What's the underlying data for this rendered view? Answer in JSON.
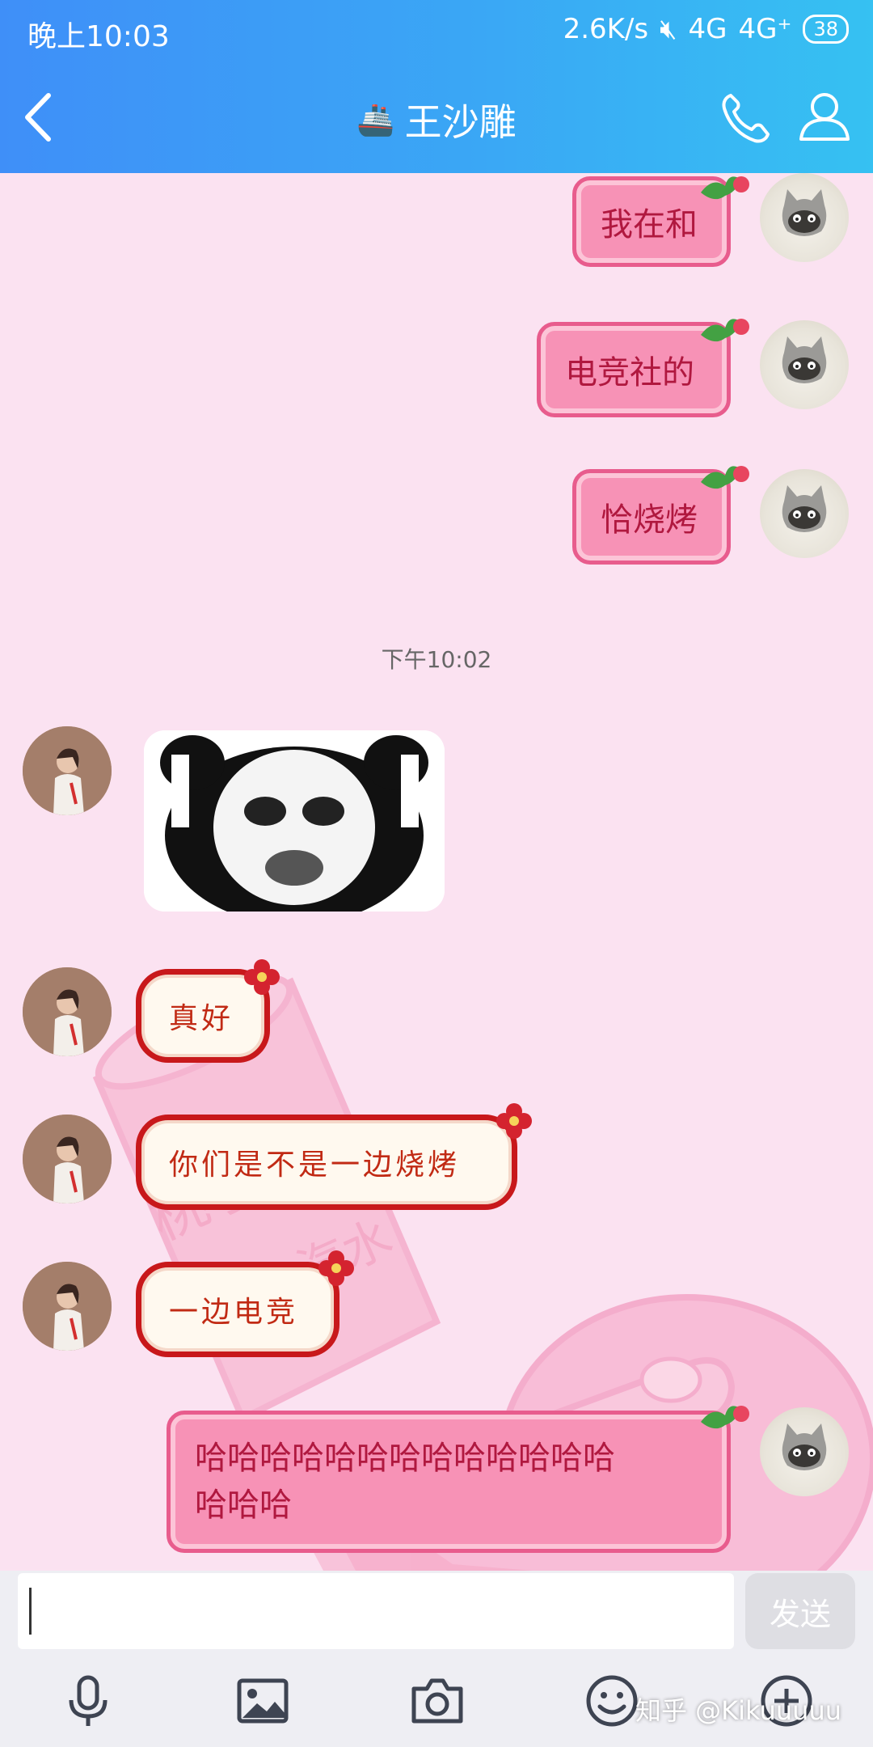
{
  "status_bar": {
    "time": "晚上10:03",
    "speed": "2.6K/s",
    "network1": "4G",
    "network2": "4G⁺",
    "battery": "38"
  },
  "header": {
    "title": "王沙雕",
    "title_emoji": "🚢"
  },
  "messages": {
    "m1": "我在和",
    "m2": "电竞社的",
    "m3": "恰烧烤",
    "timestamp": "下午10:02",
    "m4": "真好",
    "m5": "你们是不是一边烧烤",
    "m6": "一边电竞",
    "m7_line1": "哈哈哈哈哈哈哈哈哈哈哈哈哈",
    "m7_line2": "哈哈哈"
  },
  "input": {
    "value": "",
    "send_label": "发送"
  },
  "watermark": "知乎 @Kikuuuuu",
  "colors": {
    "header_start": "#3f8ff8",
    "header_end": "#36c1f2",
    "chat_bg": "#fbe2f1",
    "pink_bubble": "#f792b6",
    "red_bubble_border": "#c8181b"
  }
}
